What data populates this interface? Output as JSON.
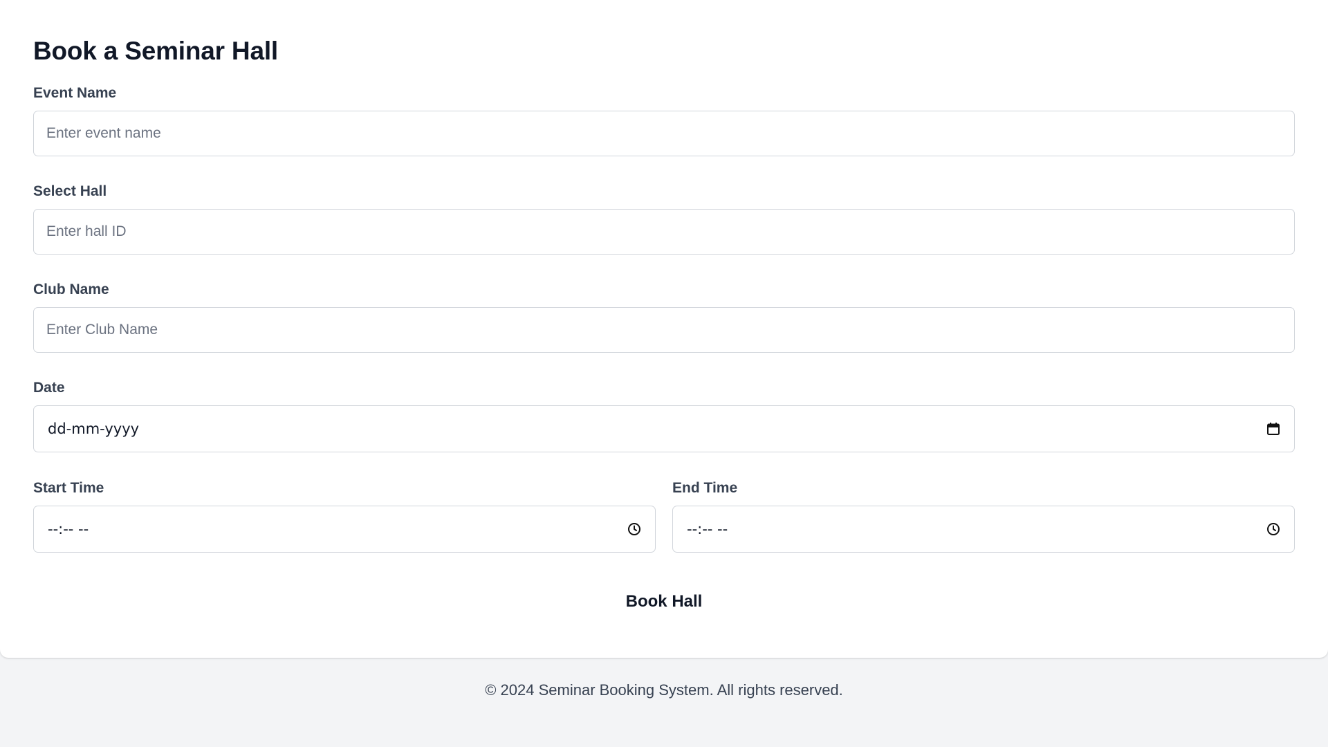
{
  "form": {
    "title": "Book a Seminar Hall",
    "event_name": {
      "label": "Event Name",
      "placeholder": "Enter event name",
      "value": ""
    },
    "hall": {
      "label": "Select Hall",
      "placeholder": "Enter hall ID",
      "value": ""
    },
    "club_name": {
      "label": "Club Name",
      "placeholder": "Enter Club Name",
      "value": ""
    },
    "date": {
      "label": "Date",
      "display": "dd-mm-yyyy",
      "icon": "calendar-icon"
    },
    "start_time": {
      "label": "Start Time",
      "display": "--:-- --",
      "icon": "clock-icon"
    },
    "end_time": {
      "label": "End Time",
      "display": "--:-- --",
      "icon": "clock-icon"
    },
    "submit_label": "Book Hall"
  },
  "footer": {
    "text": "© 2024 Seminar Booking System. All rights reserved."
  },
  "colors": {
    "page_bg": "#f3f4f6",
    "card_bg": "#ffffff",
    "border": "#d1d5db",
    "text": "#111827",
    "label": "#374151"
  }
}
